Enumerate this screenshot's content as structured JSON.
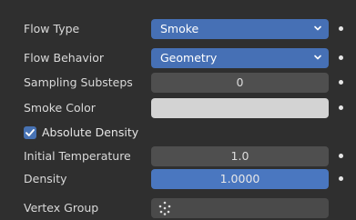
{
  "flow_type": {
    "label": "Flow Type",
    "value": "Smoke"
  },
  "flow_behavior": {
    "label": "Flow Behavior",
    "value": "Geometry"
  },
  "sampling_substeps": {
    "label": "Sampling Substeps",
    "value": "0"
  },
  "smoke_color": {
    "label": "Smoke Color",
    "color": "#d3d3d3"
  },
  "absolute_density": {
    "label": "Absolute Density",
    "checked": true
  },
  "initial_temperature": {
    "label": "Initial Temperature",
    "value": "1.0"
  },
  "density": {
    "label": "Density",
    "value": "1.0000"
  },
  "vertex_group": {
    "label": "Vertex Group",
    "icon": "vertex-group-icon"
  }
}
